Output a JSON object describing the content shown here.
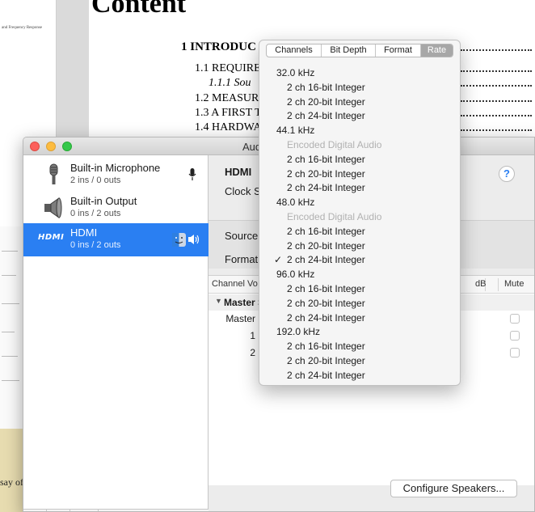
{
  "document": {
    "title": "Content",
    "toc": [
      {
        "label": "1 INTRODUC",
        "style": "bold"
      },
      {
        "label": "1.1 REQUIRE",
        "style": "normal"
      },
      {
        "label": "1.1.1 Sou",
        "style": "italic"
      },
      {
        "label": "1.2 MEASUR",
        "style": "normal"
      },
      {
        "label": "1.3 A FIRST T",
        "style": "normal"
      },
      {
        "label": "1.4 HARDWA",
        "style": "normal"
      }
    ],
    "left_page_tiny_text": [
      "and Frequency Response"
    ],
    "bottom_text": "say of"
  },
  "window": {
    "title": "Audi"
  },
  "sidebar": {
    "devices": [
      {
        "name": "Built-in Microphone",
        "sub": "2 ins / 0 outs"
      },
      {
        "name": "Built-in Output",
        "sub": "0 ins / 2 outs"
      },
      {
        "name": "HDMI",
        "sub": "0 ins / 2 outs",
        "logo": "HDMI"
      }
    ],
    "add_label": "+",
    "remove_label": "−",
    "gear_label": "⚙︎⌄"
  },
  "detail": {
    "device_name": "HDMI",
    "clock_label": "Clock S",
    "help_label": "?",
    "source_label": "Source",
    "format_label": "Format",
    "table": {
      "headers": [
        "Channel Vo",
        "dB",
        "Mute"
      ],
      "group": "Master S",
      "rows": [
        "Master",
        "1",
        "2"
      ]
    },
    "configure_button": "Configure Speakers..."
  },
  "popover": {
    "tabs": [
      "Channels",
      "Bit Depth",
      "Format",
      "Rate"
    ],
    "selected_tab": "Rate",
    "groups": [
      {
        "rate": "32.0 kHz",
        "options": [
          {
            "label": "2 ch 16-bit Integer",
            "enabled": true,
            "checked": false
          },
          {
            "label": "2 ch 20-bit Integer",
            "enabled": true,
            "checked": false
          },
          {
            "label": "2 ch 24-bit Integer",
            "enabled": true,
            "checked": false
          }
        ]
      },
      {
        "rate": "44.1 kHz",
        "options": [
          {
            "label": "Encoded Digital Audio",
            "enabled": false,
            "checked": false
          },
          {
            "label": "2 ch 16-bit Integer",
            "enabled": true,
            "checked": false
          },
          {
            "label": "2 ch 20-bit Integer",
            "enabled": true,
            "checked": false
          },
          {
            "label": "2 ch 24-bit Integer",
            "enabled": true,
            "checked": false
          }
        ]
      },
      {
        "rate": "48.0 kHz",
        "options": [
          {
            "label": "Encoded Digital Audio",
            "enabled": false,
            "checked": false
          },
          {
            "label": "2 ch 16-bit Integer",
            "enabled": true,
            "checked": false
          },
          {
            "label": "2 ch 20-bit Integer",
            "enabled": true,
            "checked": false
          },
          {
            "label": "2 ch 24-bit Integer",
            "enabled": true,
            "checked": true
          }
        ]
      },
      {
        "rate": "96.0 kHz",
        "options": [
          {
            "label": "2 ch 16-bit Integer",
            "enabled": true,
            "checked": false
          },
          {
            "label": "2 ch 20-bit Integer",
            "enabled": true,
            "checked": false
          },
          {
            "label": "2 ch 24-bit Integer",
            "enabled": true,
            "checked": false
          }
        ]
      },
      {
        "rate": "192.0 kHz",
        "options": [
          {
            "label": "2 ch 16-bit Integer",
            "enabled": true,
            "checked": false
          },
          {
            "label": "2 ch 20-bit Integer",
            "enabled": true,
            "checked": false
          },
          {
            "label": "2 ch 24-bit Integer",
            "enabled": true,
            "checked": false
          }
        ]
      }
    ],
    "check_glyph": "✓"
  },
  "colors": {
    "selection": "#2a7ff2",
    "close": "#fc605c",
    "minimize": "#fdbc40",
    "zoom": "#34c84a"
  }
}
